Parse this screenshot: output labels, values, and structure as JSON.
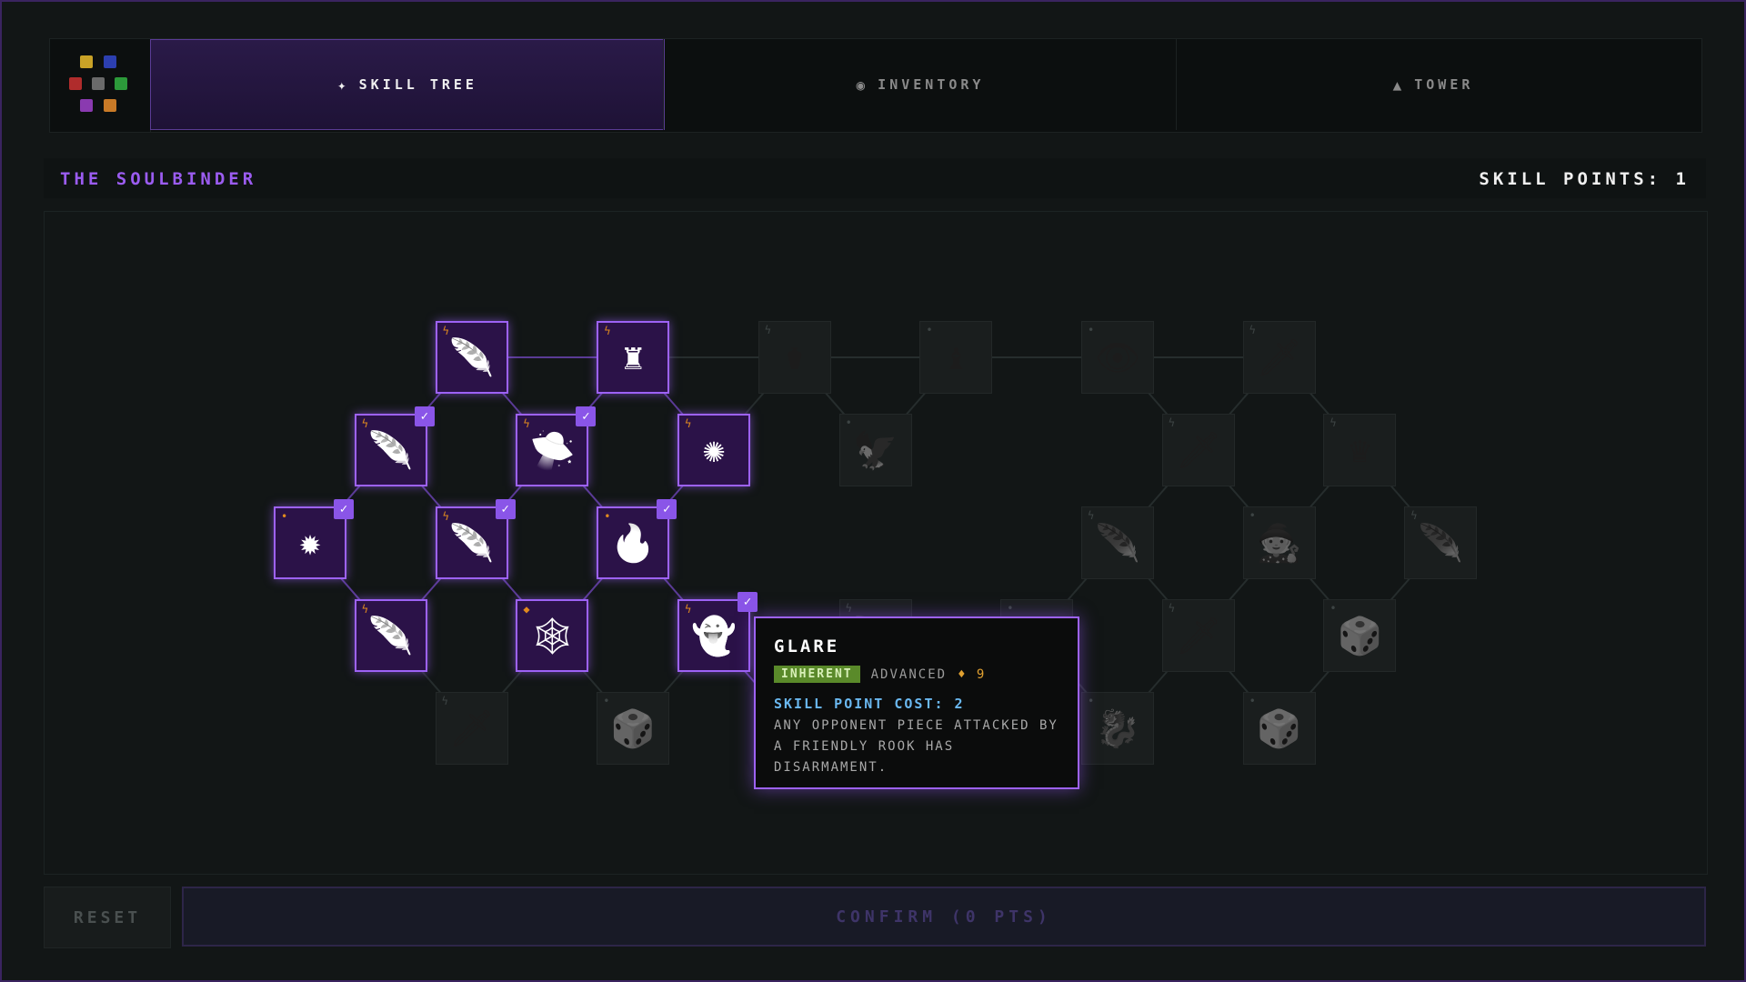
{
  "tabs": [
    {
      "icon": "sparkle-icon",
      "glyph": "✦",
      "label": "SKILL TREE",
      "active": true
    },
    {
      "icon": "orb-icon",
      "glyph": "◉",
      "label": "INVENTORY",
      "active": false
    },
    {
      "icon": "triangle-icon",
      "glyph": "▲",
      "label": "TOWER",
      "active": false
    }
  ],
  "logo_colors": [
    "#c9a227",
    "#2c3fb0",
    "#b02c2c",
    "#6a6a6a",
    "#2c9a3a",
    "#8a3ab0",
    "#c97a27"
  ],
  "header": {
    "character": "THE SOULBINDER",
    "skill_points": "SKILL POINTS: 1"
  },
  "nodes": [
    {
      "id": "n1",
      "glyph": "🪶",
      "icon": "feather-icon",
      "state": "on",
      "mark": "ϟ",
      "checked": false
    },
    {
      "id": "n2",
      "glyph": "♜",
      "icon": "rook-tower-icon",
      "state": "on",
      "mark": "ϟ",
      "checked": false
    },
    {
      "id": "n3",
      "glyph": "⚱",
      "icon": "vase-icon",
      "state": "off",
      "mark": "ϟ",
      "checked": false
    },
    {
      "id": "n4",
      "glyph": "♝",
      "icon": "shrine-icon",
      "state": "off",
      "mark": "•",
      "checked": false
    },
    {
      "id": "n5",
      "glyph": "👁",
      "icon": "eye-icon",
      "state": "off",
      "mark": "•",
      "checked": false
    },
    {
      "id": "n6",
      "glyph": "🗡",
      "icon": "dagger-icon",
      "state": "off",
      "mark": "ϟ",
      "checked": false
    },
    {
      "id": "n7",
      "glyph": "🪶",
      "icon": "feather-icon",
      "state": "on",
      "mark": "ϟ",
      "checked": true
    },
    {
      "id": "n8",
      "glyph": "🛸",
      "icon": "ufo-icon",
      "state": "on",
      "mark": "ϟ",
      "checked": true
    },
    {
      "id": "n9",
      "glyph": "✺",
      "icon": "seal-icon",
      "state": "on",
      "mark": "ϟ",
      "checked": false
    },
    {
      "id": "n10",
      "glyph": "🦅",
      "icon": "wing-icon",
      "state": "off",
      "mark": "•",
      "checked": false
    },
    {
      "id": "n11",
      "glyph": "🗡",
      "icon": "dagger-icon",
      "state": "off",
      "mark": "ϟ",
      "checked": false
    },
    {
      "id": "n12",
      "glyph": "♛",
      "icon": "crown-icon",
      "state": "off",
      "mark": "ϟ",
      "checked": false
    },
    {
      "id": "n13",
      "glyph": "✹",
      "icon": "sun-icon",
      "state": "on",
      "mark": "•",
      "checked": true
    },
    {
      "id": "n14",
      "glyph": "🪶",
      "icon": "feather-icon",
      "state": "on",
      "mark": "ϟ",
      "checked": true
    },
    {
      "id": "n15",
      "glyph": "🔥",
      "icon": "flame-icon",
      "state": "on",
      "mark": "•",
      "checked": true
    },
    {
      "id": "n16",
      "glyph": "🪶",
      "icon": "feather-icon",
      "state": "off",
      "mark": "ϟ",
      "checked": false
    },
    {
      "id": "n17",
      "glyph": "🧙",
      "icon": "cloak-icon",
      "state": "off",
      "mark": "•",
      "checked": false
    },
    {
      "id": "n18",
      "glyph": "🪶",
      "icon": "feather-icon",
      "state": "off",
      "mark": "ϟ",
      "checked": false
    },
    {
      "id": "n19",
      "glyph": "🪶",
      "icon": "feather-icon",
      "state": "on",
      "mark": "ϟ",
      "checked": false
    },
    {
      "id": "n20",
      "glyph": "🕸",
      "icon": "net-icon",
      "state": "on",
      "mark": "◆",
      "checked": false
    },
    {
      "id": "n21",
      "glyph": "👻",
      "icon": "ghost-icon",
      "state": "on",
      "mark": "ϟ",
      "checked": true
    },
    {
      "id": "n22",
      "glyph": "🪶",
      "icon": "feather-icon",
      "state": "off",
      "mark": "ϟ",
      "checked": false
    },
    {
      "id": "n23",
      "glyph": "⚓",
      "icon": "anchor-icon",
      "state": "off",
      "mark": "•",
      "checked": false
    },
    {
      "id": "n24",
      "glyph": "🗡",
      "icon": "dagger-icon",
      "state": "off",
      "mark": "ϟ",
      "checked": false
    },
    {
      "id": "n25",
      "glyph": "🎲",
      "icon": "dice-icon",
      "state": "off",
      "mark": "•",
      "checked": false
    },
    {
      "id": "n26",
      "glyph": "🗡",
      "icon": "sword-icon",
      "state": "off",
      "mark": "ϟ",
      "checked": false
    },
    {
      "id": "n27",
      "glyph": "🎲",
      "icon": "dice-icon",
      "state": "off",
      "mark": "•",
      "checked": false
    },
    {
      "id": "n28",
      "glyph": "👻",
      "icon": "ghost-icon",
      "state": "on",
      "mark": "ϟ",
      "checked": false
    },
    {
      "id": "n29",
      "glyph": "🎲",
      "icon": "dice-icon",
      "state": "off",
      "mark": "•",
      "checked": false
    },
    {
      "id": "n30",
      "glyph": "🐉",
      "icon": "beast-icon",
      "state": "off",
      "mark": "•",
      "checked": false
    },
    {
      "id": "n31",
      "glyph": "🎲",
      "icon": "dice-icon",
      "state": "off",
      "mark": "•",
      "checked": false
    }
  ],
  "tooltip": {
    "title": "GLARE",
    "tag": "INHERENT",
    "tier": "ADVANCED",
    "rank": "♦ 9",
    "cost": "SKILL POINT COST: 2",
    "description": "ANY OPPONENT PIECE ATTACKED BY A FRIENDLY ROOK HAS DISARMAMENT."
  },
  "buttons": {
    "reset": "RESET",
    "confirm": "CONFIRM (0 PTS)"
  }
}
